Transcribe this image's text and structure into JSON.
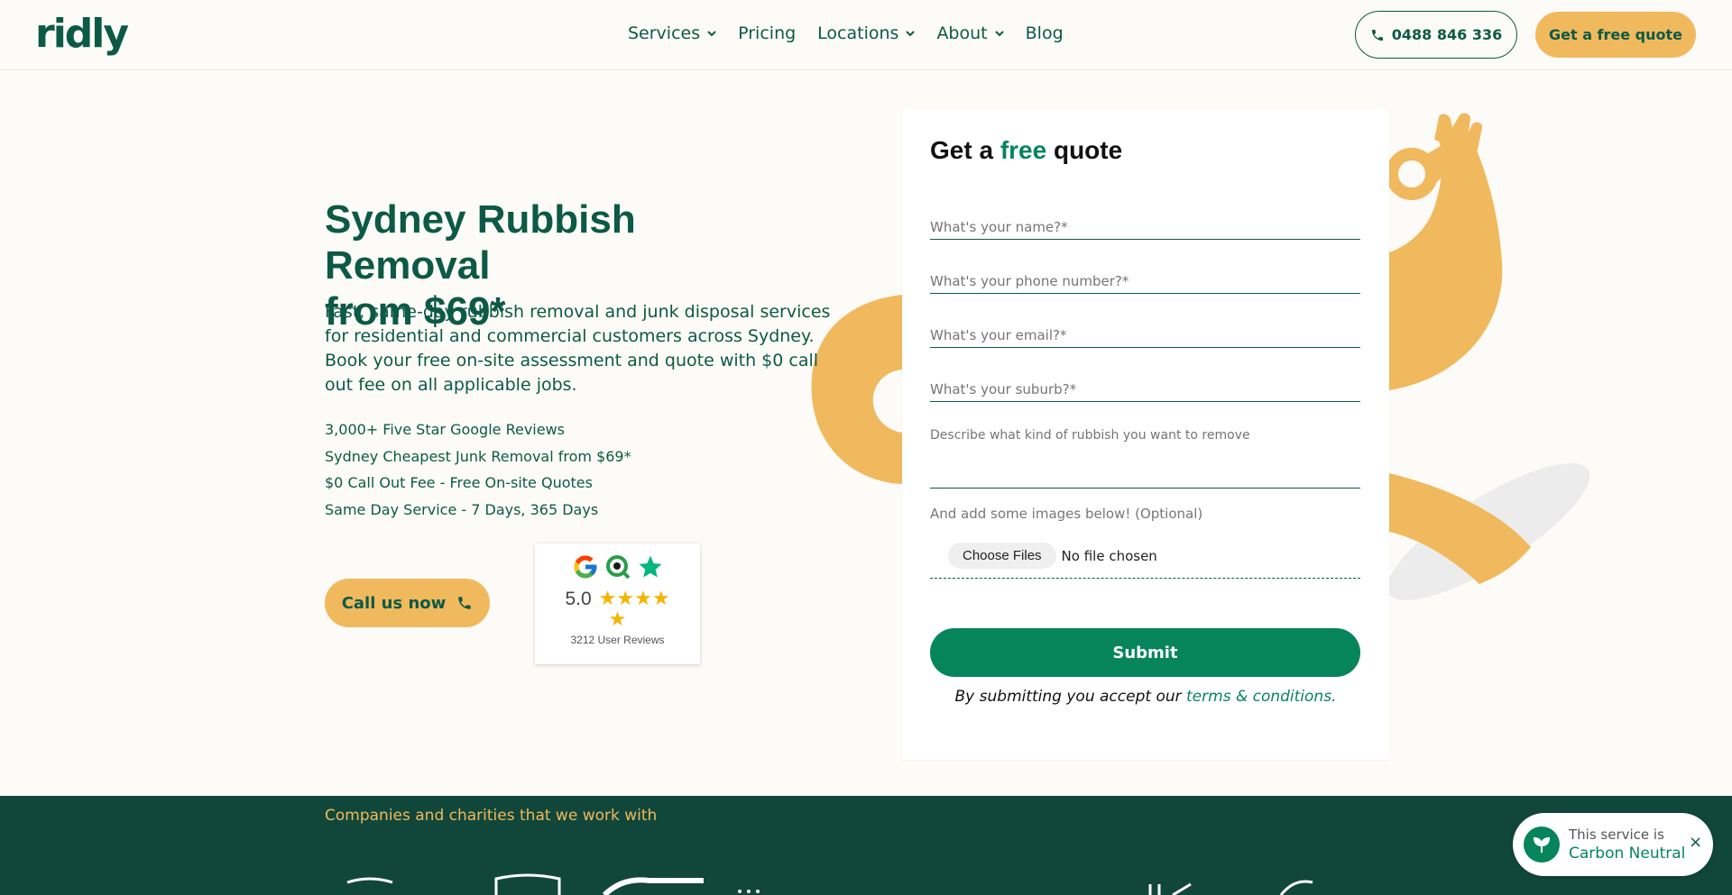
{
  "header": {
    "logo": "ridly",
    "nav": [
      {
        "label": "Services",
        "dropdown": true
      },
      {
        "label": "Pricing",
        "dropdown": false
      },
      {
        "label": "Locations",
        "dropdown": true
      },
      {
        "label": "About",
        "dropdown": true
      },
      {
        "label": "Blog",
        "dropdown": false
      }
    ],
    "phone": "0488 846 336",
    "quote_button": "Get a free quote"
  },
  "hero": {
    "title_line1": "Sydney Rubbish Removal",
    "title_line2": "from $69*",
    "description": "Fast, same-day rubbish removal and junk disposal services for residential and commercial customers across Sydney. Book your free on-site assessment and quote with $0 call out fee on all applicable jobs.",
    "bullets": [
      "3,000+ Five Star Google Reviews",
      "Sydney Cheapest Junk Removal from $69*",
      "$0 Call Out Fee - Free On-site Quotes",
      "Same Day Service - 7 Days, 365 Days"
    ],
    "call_button": "Call us now",
    "reviews": {
      "rating": "5.0",
      "count_label": "3212 User Reviews",
      "stars": 5
    }
  },
  "form": {
    "title_before": "Get a",
    "title_highlight": "free",
    "title_after": "quote",
    "fields": {
      "name_placeholder": "What's your name?*",
      "phone_placeholder": "What's your phone number?*",
      "email_placeholder": "What's your email?*",
      "suburb_placeholder": "What's your suburb?*",
      "rubbish_placeholder": "Describe what kind of rubbish you want to remove"
    },
    "images_label": "And add some images below! (Optional)",
    "file_button": "Choose Files",
    "file_status": "No file chosen",
    "submit": "Submit",
    "terms_before": "By submitting you accept our",
    "terms_link": "terms & conditions."
  },
  "partners": {
    "title": "Companies and charities that we work with"
  },
  "toast": {
    "line1": "This service is",
    "line2": "Carbon Neutral",
    "close": "×"
  },
  "colors": {
    "brand_green": "#0c5a45",
    "accent_green": "#07855a",
    "accent_orange": "#f1b95d",
    "footer_green": "#11473a"
  }
}
